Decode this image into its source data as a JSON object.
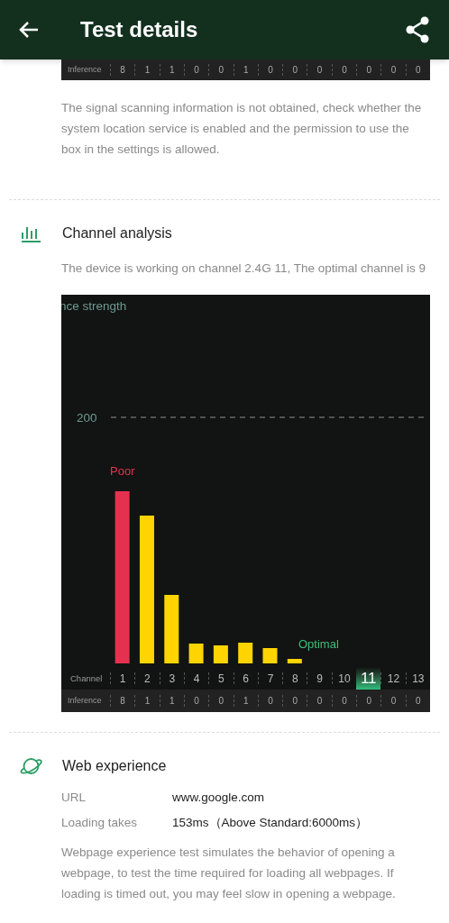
{
  "header": {
    "title": "Test details"
  },
  "top_inference": {
    "label": "Inference",
    "values": [
      "8",
      "1",
      "1",
      "0",
      "0",
      "1",
      "0",
      "0",
      "0",
      "0",
      "0",
      "0",
      "0"
    ]
  },
  "scan_note": "The signal scanning information is not obtained, check whether the system location service is enabled and the permission to use the box in the settings is allowed.",
  "channel_analysis": {
    "title": "Channel analysis",
    "subtitle": "The device is working on channel 2.4G 11, The optimal channel is 9",
    "chart": {
      "axis_title": "nce strength",
      "tick": "200",
      "poor_label": "Poor",
      "optimal_label": "Optimal",
      "channel_label": "Channel",
      "channels": [
        {
          "label": "1",
          "selected": false
        },
        {
          "label": "2",
          "selected": false
        },
        {
          "label": "3",
          "selected": false
        },
        {
          "label": "4",
          "selected": false
        },
        {
          "label": "5",
          "selected": false
        },
        {
          "label": "6",
          "selected": false
        },
        {
          "label": "7",
          "selected": false
        },
        {
          "label": "8",
          "selected": false
        },
        {
          "label": "9",
          "selected": false
        },
        {
          "label": "10",
          "selected": false
        },
        {
          "label": "11",
          "selected": true
        },
        {
          "label": "12",
          "selected": false
        },
        {
          "label": "13",
          "selected": false
        }
      ],
      "inference_label": "Inference",
      "inference": [
        "8",
        "1",
        "1",
        "0",
        "0",
        "1",
        "0",
        "0",
        "0",
        "0",
        "0",
        "0",
        "0"
      ]
    }
  },
  "web_experience": {
    "title": "Web experience",
    "rows": [
      {
        "label": "URL",
        "value": "www.google.com"
      },
      {
        "label": "Loading takes",
        "value": "153ms（Above Standard:6000ms）"
      }
    ],
    "note": "Webpage experience test simulates the behavior of opening a webpage, to test the time required for loading all webpages. If loading is timed out, you may feel slow in opening a webpage."
  }
}
